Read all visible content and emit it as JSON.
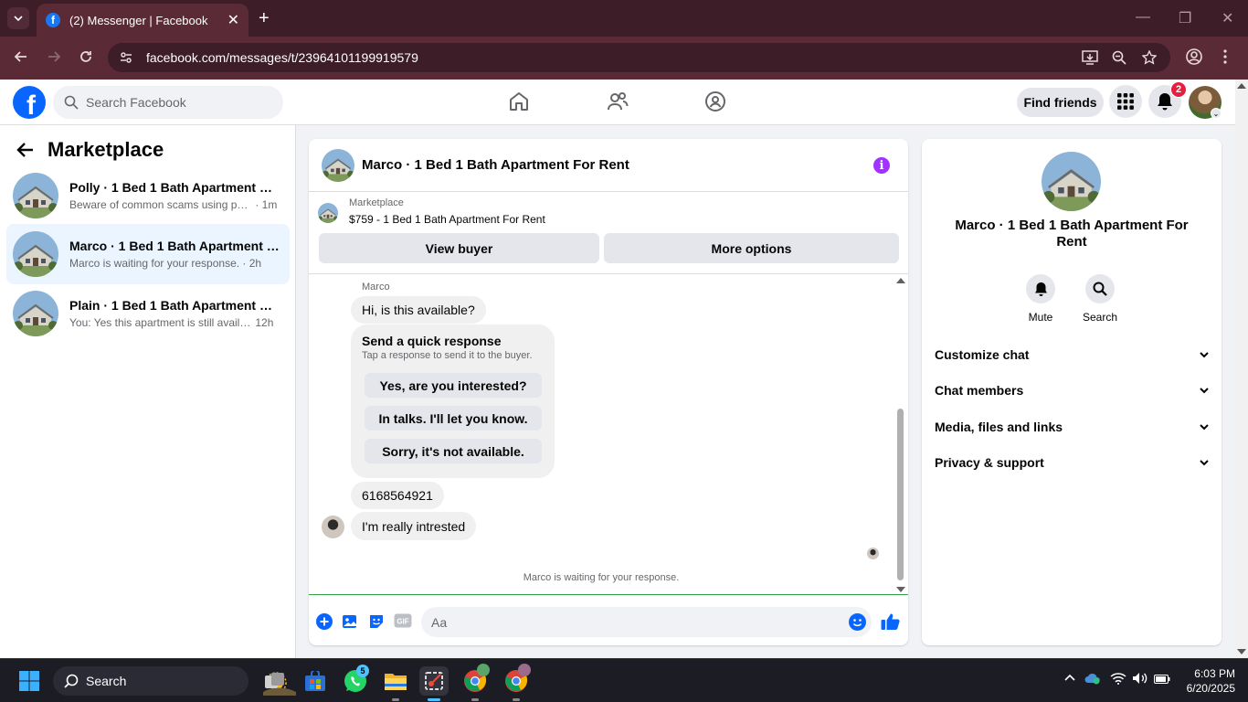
{
  "browser": {
    "tab_title": "(2) Messenger | Facebook",
    "url": "facebook.com/messages/t/23964101199919579"
  },
  "header": {
    "search_placeholder": "Search Facebook",
    "find_friends": "Find friends",
    "notification_count": "2"
  },
  "sidebar": {
    "title": "Marketplace",
    "conversations": [
      {
        "name": "Polly · 1 Bed 1 Bath Apartment For ...",
        "preview": "Beware of common scams using pay...",
        "time": "· 1m",
        "active": false
      },
      {
        "name": "Marco · 1 Bed 1 Bath Apartment Fo...",
        "preview": "Marco is waiting for your response.",
        "time": "· 2h",
        "active": true
      },
      {
        "name": "Plain · 1 Bed 1 Bath Apartment For ...",
        "preview": "You: Yes this apartment is still availab...",
        "time": "12h",
        "active": false
      }
    ]
  },
  "chat": {
    "title": "Marco · 1 Bed 1 Bath Apartment For Rent",
    "marketplace_label": "Marketplace",
    "listing": "$759 - 1 Bed 1 Bath Apartment For Rent",
    "view_buyer": "View buyer",
    "more_options": "More options",
    "sender": "Marco",
    "messages": [
      "Hi, is this available?",
      "6168564921",
      "I'm really intrested"
    ],
    "quick_response": {
      "title": "Send a quick response",
      "subtitle": "Tap a response to send it to the buyer.",
      "options": [
        "Yes, are you interested?",
        "In talks. I'll let you know.",
        "Sorry, it's not available."
      ]
    },
    "waiting": "Marco is waiting for your response.",
    "input_placeholder": "Aa"
  },
  "details": {
    "name": "Marco · 1 Bed 1 Bath Apartment For Rent",
    "mute": "Mute",
    "search": "Search",
    "sections": [
      "Customize chat",
      "Chat members",
      "Media, files and links",
      "Privacy & support"
    ]
  },
  "taskbar": {
    "search": "Search",
    "whatsapp_badge": "5",
    "time": "6:03 PM",
    "date": "6/20/2025"
  },
  "colors": {
    "fb_blue": "#0866ff",
    "messenger_purple": "#a033ff",
    "browser_frame": "#3c1d28"
  }
}
